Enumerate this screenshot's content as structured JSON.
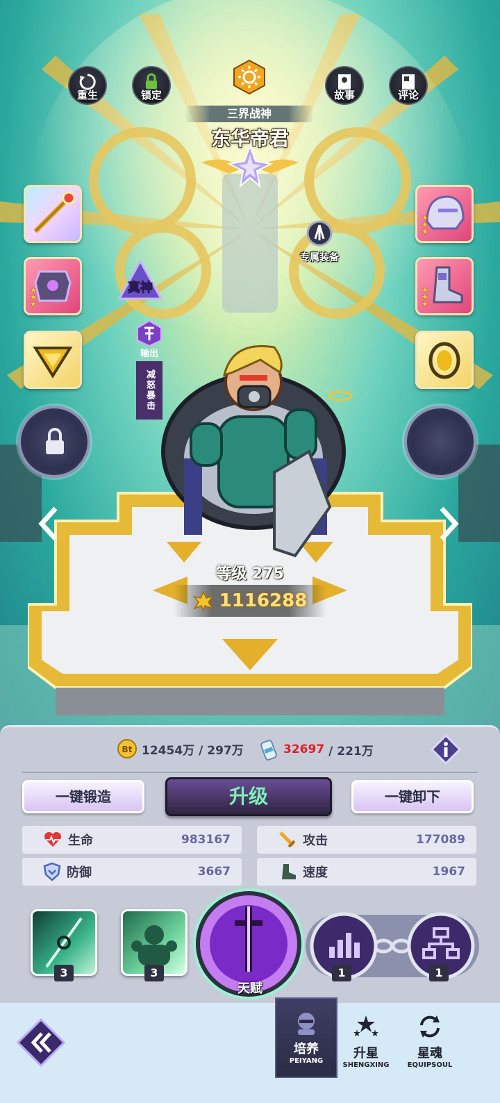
{
  "top_menu": {
    "rebirth": "重生",
    "lock": "锁定",
    "story": "故事",
    "comment": "评论"
  },
  "hero": {
    "subtitle": "三界战神",
    "name": "东华帝君",
    "rank_badge": "真神",
    "role_main": "输出",
    "role_traits": "减怒暴击",
    "level_label": "等级 275",
    "power": "1116288",
    "exclusive_equip_label": "专属装备"
  },
  "icons": {
    "left_slots": [
      "staff-icon",
      "chest-armor-icon",
      "triangle-gem-icon"
    ],
    "right_slots": [
      "helmet-icon",
      "boots-icon",
      "ring-icon"
    ]
  },
  "resources": {
    "coin_amount": "12454万",
    "coin_cost": "/ 297万",
    "exp_amount": "32697",
    "exp_cost": "/ 221万"
  },
  "actions": {
    "forge_all": "一键锻造",
    "upgrade": "升级",
    "unequip_all": "一键卸下"
  },
  "stats": [
    {
      "name": "生命",
      "value": "983167"
    },
    {
      "name": "攻击",
      "value": "177089"
    },
    {
      "name": "防御",
      "value": "3667"
    },
    {
      "name": "速度",
      "value": "1967"
    }
  ],
  "skills": {
    "skill1_level": "3",
    "skill2_level": "3",
    "talent_label": "天赋",
    "bond1_level": "1",
    "bond2_level": "1"
  },
  "nav": {
    "tabs": [
      {
        "cn": "培养",
        "en": "PEIYANG"
      },
      {
        "cn": "升星",
        "en": "SHENGXING"
      },
      {
        "cn": "星魂",
        "en": "EQUIPSOUL"
      }
    ]
  },
  "colors": {
    "accent_purple": "#4b2f6b",
    "upgrade_text": "#7ef0b6",
    "exp_warning": "#e0202a",
    "power_gold": "#ffe27a"
  }
}
